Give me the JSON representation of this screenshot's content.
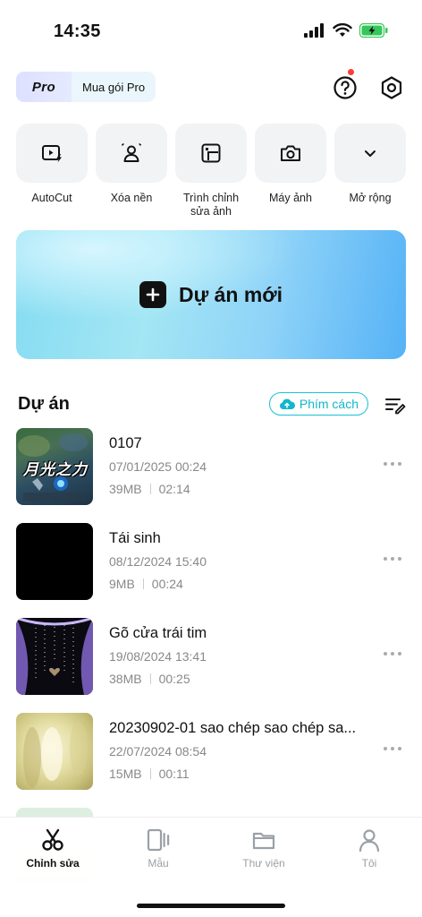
{
  "status": {
    "time": "14:35"
  },
  "header": {
    "pro_badge": "Pro",
    "buy_label": "Mua gói Pro"
  },
  "tools": [
    {
      "label": "AutoCut",
      "icon": "autocut-icon"
    },
    {
      "label": "Xóa nền",
      "icon": "remove-bg-icon"
    },
    {
      "label": "Trình chỉnh\nsửa ảnh",
      "icon": "photo-editor-icon"
    },
    {
      "label": "Máy ảnh",
      "icon": "camera-icon"
    },
    {
      "label": "Mở rộng",
      "icon": "chevron-down-icon"
    }
  ],
  "new_project": {
    "label": "Dự án mới"
  },
  "projects_section": {
    "title": "Dự án",
    "space_label": "Phím cách"
  },
  "projects": [
    {
      "name": "0107",
      "date": "07/01/2025 00:24",
      "size": "39MB",
      "duration": "02:14"
    },
    {
      "name": "Tái sinh",
      "date": "08/12/2024 15:40",
      "size": "9MB",
      "duration": "00:24"
    },
    {
      "name": "Gõ cửa trái tim",
      "date": "19/08/2024 13:41",
      "size": "38MB",
      "duration": "00:25"
    },
    {
      "name": "20230902-01 sao chép sao chép sa...",
      "date": "22/07/2024 08:54",
      "size": "15MB",
      "duration": "00:11"
    }
  ],
  "thumb_texts": {
    "game_title": "月光之力"
  },
  "tabbar": {
    "edit": "Chỉnh sửa",
    "templates": "Mẫu",
    "library": "Thư viện",
    "me": "Tôi"
  },
  "colors": {
    "accent": "#10b7cc",
    "notification": "#ff3b3b",
    "battery": "#34c759"
  }
}
